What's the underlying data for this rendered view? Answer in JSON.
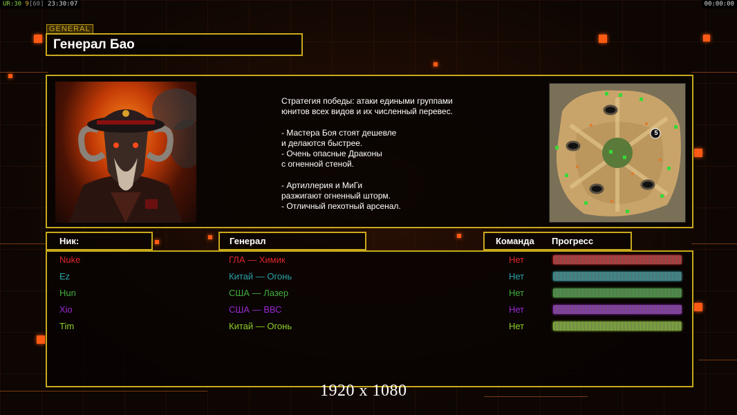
{
  "status": {
    "left_a": "UR:30",
    "left_b": "9",
    "left_c": "[60]",
    "left_d": "23:30:07",
    "right": "00:00:00"
  },
  "header": {
    "tag": "GENERAL",
    "title": "Генерал Бао"
  },
  "info": {
    "description_lines": [
      "Стратегия победы: атаки едиными группами",
      "юнитов всех видов и их численный перевес.",
      "",
      "- Мастера Боя стоят дешевле",
      "и делаются быстрее.",
      "- Очень опасные Драконы",
      "с огненной стеной.",
      "",
      "- Артиллерия и МиГи",
      "разжигают огненный шторм.",
      "- Отличный пехотный арсенал."
    ],
    "map_marker": "5"
  },
  "columns": {
    "nick": "Ник:",
    "general": "Генерал",
    "team": "Команда",
    "progress": "Прогресс"
  },
  "players": [
    {
      "nick": "Nuke",
      "general": "ГЛА — Химик",
      "team": "Нет",
      "color": "#e0262a",
      "progress": 1.0
    },
    {
      "nick": "Ez",
      "general": "Китай — Огонь",
      "team": "Нет",
      "color": "#2aa3a8",
      "progress": 1.0
    },
    {
      "nick": "Hun",
      "general": "США — Лазер",
      "team": "Нет",
      "color": "#3fae3a",
      "progress": 1.0
    },
    {
      "nick": "Xio",
      "general": "США — ВВС",
      "team": "Нет",
      "color": "#9a2bd2",
      "progress": 1.0
    },
    {
      "nick": "Tim",
      "general": "Китай — Огонь",
      "team": "Нет",
      "color": "#8fd22a",
      "progress": 1.0
    }
  ],
  "footer": {
    "resolution": "1920 x 1080"
  },
  "colors": {
    "accent_border": "#c9aa1c",
    "decor_orange": "#ff5a14",
    "background": "#0d0603"
  }
}
